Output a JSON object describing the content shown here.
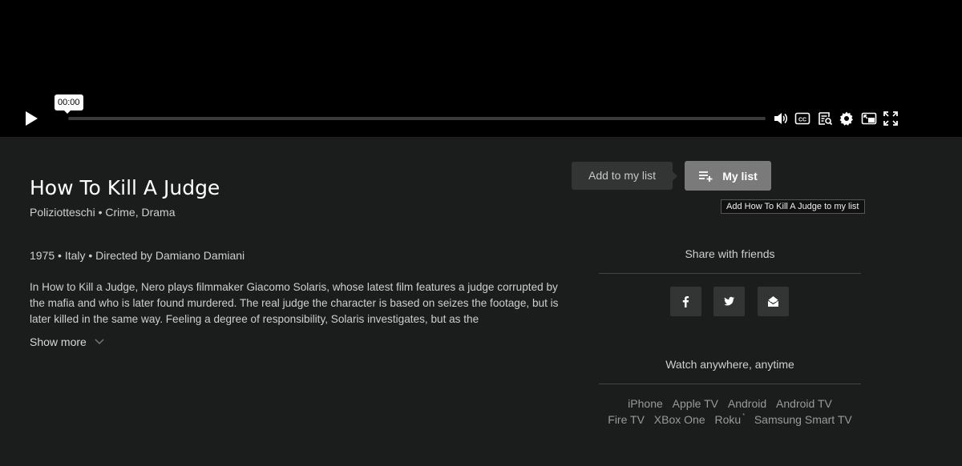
{
  "player": {
    "time_tooltip": "00:00",
    "controls": [
      "play-icon",
      "volume-icon",
      "captions-icon",
      "transcript-icon",
      "settings-icon",
      "picture-in-picture-icon",
      "fullscreen-icon"
    ]
  },
  "movie": {
    "title": "How To Kill A Judge",
    "genres": "Poliziotteschi • Crime, Drama",
    "meta": "1975 • Italy • Directed by Damiano Damiani",
    "description": "In How to Kill a Judge, Nero plays filmmaker Giacomo Solaris, whose latest film features a judge corrupted by the mafia and who is later found murdered. The real judge the character is based on seizes the footage, but is later killed in the same way. Feeling a degree of responsibility, Solaris investigates, but as the",
    "show_more": "Show more"
  },
  "mylist": {
    "add_label": "Add to my list",
    "button_label": "My list",
    "tooltip": "Add How To Kill A Judge to my list"
  },
  "share": {
    "title": "Share with friends",
    "icons": [
      "facebook-icon",
      "twitter-icon",
      "email-icon"
    ]
  },
  "watch": {
    "title": "Watch anywhere, anytime",
    "row1": [
      "iPhone",
      "Apple TV",
      "Android",
      "Android TV"
    ],
    "row2": [
      "Fire TV",
      "XBox One",
      "Roku",
      "Samsung Smart TV"
    ],
    "roku_mark": "*"
  },
  "colors": {
    "background": "#1b1c1c",
    "player_background": "#000000",
    "button_gray": "#7a7a7a"
  }
}
